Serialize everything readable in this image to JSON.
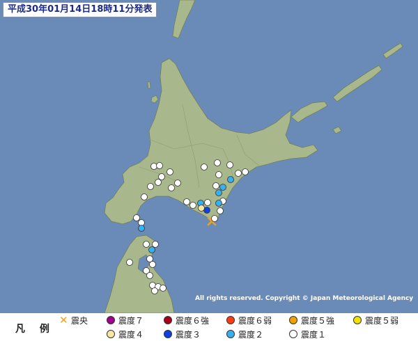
{
  "header": {
    "title": "平成30年01月14日18時11分発表"
  },
  "copyright": "All rights reserved. Copyright © Japan Meteorological Agency",
  "colors": {
    "sea": "#6a8bb8",
    "land": "#a9b78c",
    "land_stroke": "#6f7f5c",
    "intensity_1": "#ffffff",
    "intensity_2": "#38b0f0",
    "intensity_3": "#1040e0",
    "intensity_4": "#f7e7a6",
    "intensity_5_minus": "#f2e200",
    "intensity_5_plus": "#f2a000",
    "intensity_6_minus": "#ff3a10",
    "intensity_6_plus": "#aa0018",
    "intensity_7": "#a0008a",
    "epicenter": "#f0a020"
  },
  "legend": {
    "title": "凡 例",
    "items": [
      {
        "key": "epicenter",
        "label": "震央",
        "icon": "x-mark"
      },
      {
        "key": "intensity_7",
        "label": "震度７"
      },
      {
        "key": "intensity_6_plus",
        "label": "震度６強"
      },
      {
        "key": "intensity_6_minus",
        "label": "震度６弱"
      },
      {
        "key": "intensity_5_plus",
        "label": "震度５強"
      },
      {
        "key": "intensity_5_minus",
        "label": "震度５弱"
      },
      {
        "key": "intensity_4",
        "label": "震度４"
      },
      {
        "key": "intensity_3",
        "label": "震度３"
      },
      {
        "key": "intensity_2",
        "label": "震度２"
      },
      {
        "key": "intensity_1",
        "label": "震度１"
      }
    ]
  }
}
